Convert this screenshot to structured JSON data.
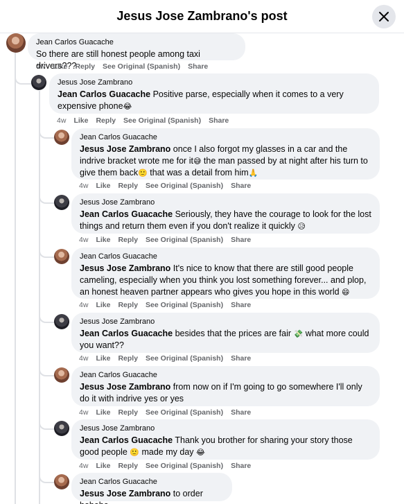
{
  "header": {
    "title": "Jesus Jose Zambrano's post"
  },
  "labels": {
    "like": "Like",
    "reply": "Reply",
    "see_original": "See Original (Spanish)",
    "share": "Share"
  },
  "comments": [
    {
      "author": "Jean Carlos Guacache",
      "mention": "",
      "text": "So there are still honest people among taxi drivers???",
      "time": "4w",
      "avatar": "tan"
    },
    {
      "author": "Jesus Jose Zambrano",
      "mention": "Jean Carlos Guacache",
      "text": " Positive parse, especially when it comes to a very expensive phone",
      "time": "4w",
      "avatar": "dark"
    },
    {
      "author": "Jean Carlos Guacache",
      "mention": "Jesus Jose Zambrano",
      "text": " once I also forgot my glasses in a car and the indrive bracket wrote me for it",
      "text2": " the man passed by at night after his turn to give them back",
      "text3": " that was a detail from him",
      "time": "4w",
      "avatar": "tan"
    },
    {
      "author": "Jesus Jose Zambrano",
      "mention": "Jean Carlos Guacache",
      "text": " Seriously, they have the courage to look for the lost things and return them even if you don't realize it quickly",
      "time": "4w",
      "avatar": "dark"
    },
    {
      "author": "Jean Carlos Guacache",
      "mention": "Jesus Jose Zambrano",
      "text": " It's nice to know that there are still good people cameling, especially when you think you lost something forever... and plop, an honest heaven partner appears who gives you hope in this world",
      "time": "4w",
      "avatar": "tan"
    },
    {
      "author": "Jesus Jose Zambrano",
      "mention": "Jean Carlos Guacache",
      "text": " besides that the prices are fair",
      "text2": " what more could you want??",
      "time": "4w",
      "avatar": "dark"
    },
    {
      "author": "Jean Carlos Guacache",
      "mention": "Jesus Jose Zambrano",
      "text": " from now on if I'm going to go somewhere I'll only do it with indrive yes or yes",
      "time": "4w",
      "avatar": "tan"
    },
    {
      "author": "Jesus Jose Zambrano",
      "mention": "Jean Carlos Guacache",
      "text": " Thank you brother for sharing your story those good people",
      "text2": " made my day",
      "time": "4w",
      "avatar": "dark"
    },
    {
      "author": "Jean Carlos Guacache",
      "mention": "Jesus Jose Zambrano",
      "text": " to order hehehe",
      "time": "",
      "avatar": "tan"
    }
  ],
  "emojis": {
    "laugh": "😂",
    "grin": "😅",
    "smile": "🙂",
    "pray": "🙏",
    "sweat": "😥",
    "happy": "😄",
    "money": "💸"
  }
}
